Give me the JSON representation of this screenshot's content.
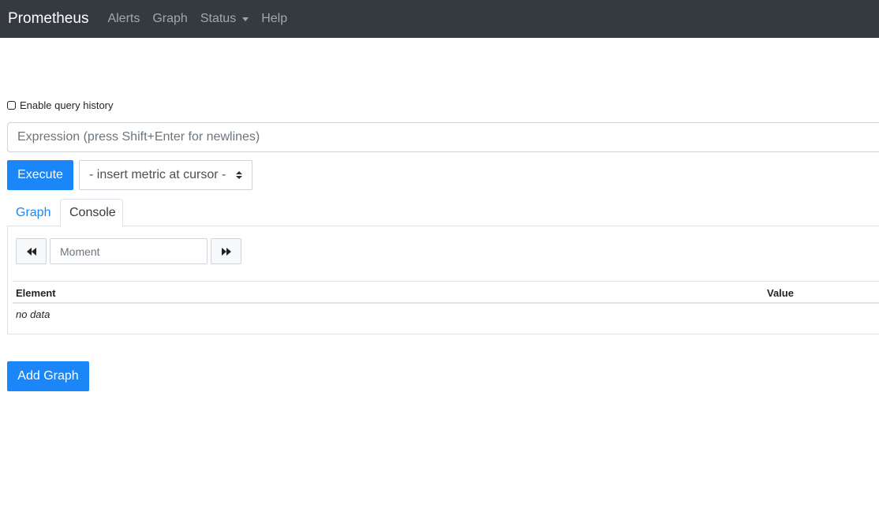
{
  "navbar": {
    "brand": "Prometheus",
    "links": [
      {
        "label": "Alerts"
      },
      {
        "label": "Graph"
      },
      {
        "label": "Status",
        "dropdown": true
      },
      {
        "label": "Help"
      }
    ]
  },
  "query_history": {
    "label": "Enable query history",
    "checked": false
  },
  "expression": {
    "value": "",
    "placeholder": "Expression (press Shift+Enter for newlines)"
  },
  "execute_label": "Execute",
  "metric_select": {
    "selected": "- insert metric at cursor -"
  },
  "tabs": [
    {
      "label": "Graph",
      "active": false
    },
    {
      "label": "Console",
      "active": true
    }
  ],
  "console": {
    "moment": {
      "value": "",
      "placeholder": "Moment"
    },
    "table": {
      "headers": [
        "Element",
        "Value"
      ],
      "empty_text": "no data"
    }
  },
  "add_graph_label": "Add Graph",
  "colors": {
    "primary": "#1a86f7",
    "navbar": "#343a40"
  }
}
